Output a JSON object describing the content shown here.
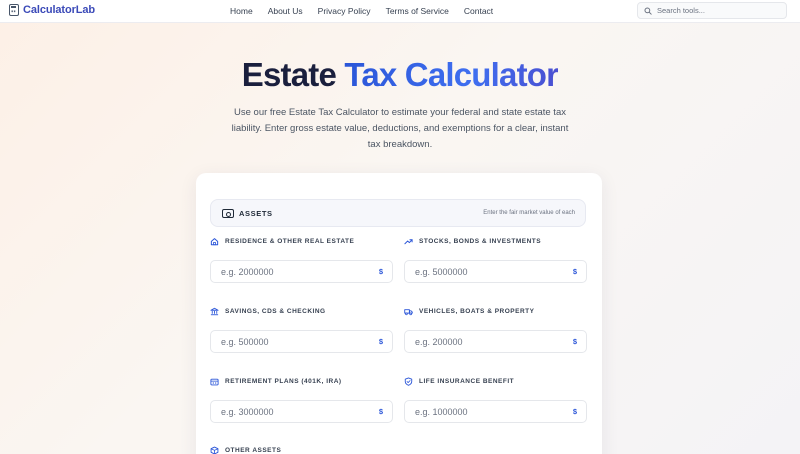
{
  "nav": {
    "brand": "CalculatorLab",
    "links": [
      "Home",
      "About Us",
      "Privacy Policy",
      "Terms of Service",
      "Contact"
    ],
    "search_placeholder": "Search tools..."
  },
  "hero": {
    "title_part1": "Estate",
    "title_part2": "Tax Calculator",
    "subtitle": "Use our free Estate Tax Calculator to estimate your federal and state estate tax liability. Enter gross estate value, deductions, and exemptions for a clear, instant tax breakdown."
  },
  "assets": {
    "section_title": "ASSETS",
    "section_hint": "Enter the fair market value of each",
    "currency_symbol": "$",
    "fields": [
      {
        "label": "RESIDENCE & OTHER REAL ESTATE",
        "placeholder": "e.g. 2000000",
        "icon": "home-icon"
      },
      {
        "label": "STOCKS, BONDS & INVESTMENTS",
        "placeholder": "e.g. 5000000",
        "icon": "trending-up-icon"
      },
      {
        "label": "SAVINGS, CDS & CHECKING",
        "placeholder": "e.g. 500000",
        "icon": "bank-icon"
      },
      {
        "label": "VEHICLES, BOATS & PROPERTY",
        "placeholder": "e.g. 200000",
        "icon": "truck-icon"
      },
      {
        "label": "RETIREMENT PLANS (401K, IRA)",
        "placeholder": "e.g. 3000000",
        "icon": "building-icon"
      },
      {
        "label": "LIFE INSURANCE BENEFIT",
        "placeholder": "e.g. 1000000",
        "icon": "shield-icon"
      },
      {
        "label": "OTHER ASSETS",
        "icon": "box-icon"
      }
    ]
  },
  "colors": {
    "accent": "#2b56d8",
    "brand": "#3b4ab8",
    "title_dark": "#1a1f3d"
  }
}
